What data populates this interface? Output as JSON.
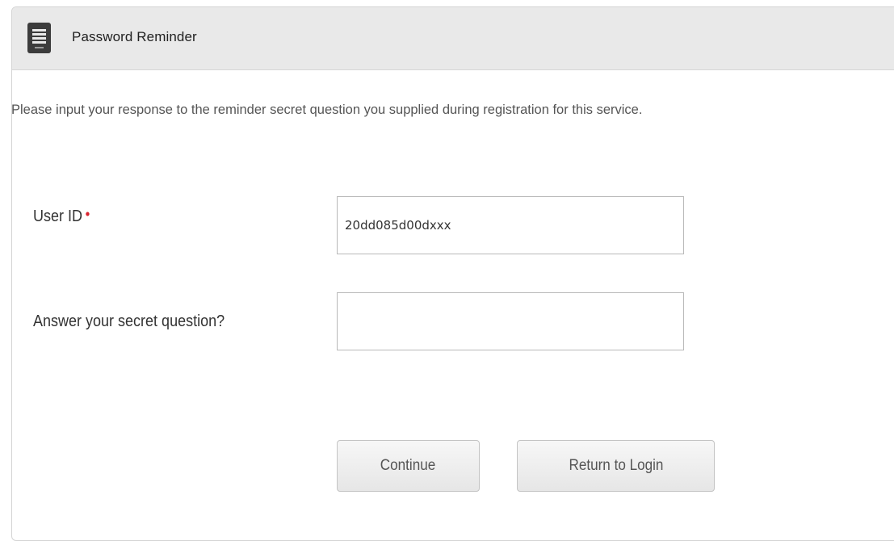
{
  "panel": {
    "title": "Password Reminder",
    "icon": "document-list-icon"
  },
  "intro": {
    "text": "Please input your response to the reminder secret question you supplied during registration for this service."
  },
  "form": {
    "user_id": {
      "label": "User ID",
      "required_marker": "•",
      "value": "20dd085d00dxxx"
    },
    "secret_answer": {
      "label": "Answer your secret question?",
      "value": ""
    }
  },
  "actions": {
    "continue_label": "Continue",
    "return_label": "Return to Login"
  },
  "colors": {
    "header_background": "#e9e9e9",
    "required_marker": "#d9232f",
    "icon_background": "#3c3c3c"
  }
}
